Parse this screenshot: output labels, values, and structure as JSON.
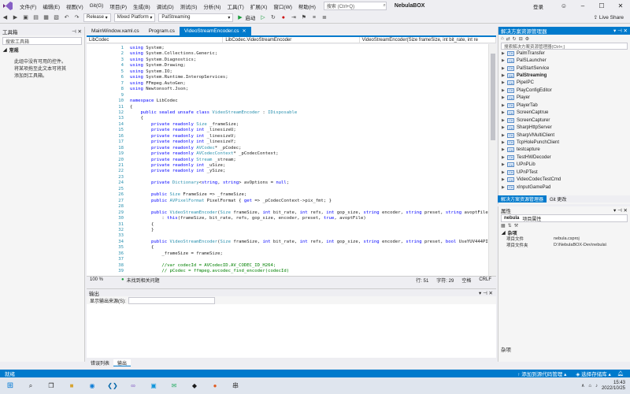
{
  "menu": {
    "items": [
      "文件(F)",
      "编辑(E)",
      "视图(V)",
      "Git(G)",
      "项目(P)",
      "生成(B)",
      "调试(D)",
      "测试(S)",
      "分析(N)",
      "工具(T)",
      "扩展(X)",
      "窗口(W)",
      "帮助(H)"
    ],
    "search_placeholder": "搜索 (Ctrl+Q)",
    "app_title": "NebulaBOX",
    "login": "登录"
  },
  "toolbar": {
    "config": "Release",
    "platform": "Mixed Platform",
    "startup_project": "PalStreaming",
    "start_label": "启动",
    "live_share": "Live Share"
  },
  "toolbox": {
    "title": "工具箱",
    "search_placeholder": "搜索工具箱",
    "group": "常规",
    "message": "此组中没有可用的控件。将某项拖至此文本可将其添加到工具箱。"
  },
  "tabs": [
    {
      "label": "MainWindow.xaml.cs"
    },
    {
      "label": "Program.cs"
    },
    {
      "label": "VideoStreamEncoder.cs"
    }
  ],
  "navbar": {
    "project": "LibCodec",
    "class": "LibCodec.VideoStreamEncoder",
    "member": "VideoStreamEncoder(Size frameSize, int bit_rate, int re"
  },
  "code_lines": [
    {
      "n": "1",
      "html": "<span class=\"kw\">using</span> System;"
    },
    {
      "n": "2",
      "html": "<span class=\"kw\">using</span> System.Collections.Generic;"
    },
    {
      "n": "3",
      "html": "<span class=\"kw\">using</span> System.Diagnostics;"
    },
    {
      "n": "4",
      "html": "<span class=\"kw\">using</span> System.Drawing;"
    },
    {
      "n": "5",
      "html": "<span class=\"kw\">using</span> System.IO;"
    },
    {
      "n": "6",
      "html": "<span class=\"kw\">using</span> System.Runtime.InteropServices;"
    },
    {
      "n": "7",
      "html": "<span class=\"kw\">using</span> FFmpeg.AutoGen;"
    },
    {
      "n": "8",
      "html": "<span class=\"kw\">using</span> Newtonsoft.Json;"
    },
    {
      "n": "9",
      "html": ""
    },
    {
      "n": "10",
      "html": "<span class=\"kw\">namespace</span> LibCodec"
    },
    {
      "n": "11",
      "html": "{"
    },
    {
      "n": "12",
      "html": "    <span class=\"kw\">public sealed unsafe class</span> <span class=\"ty\">VideoStreamEncoder</span> : <span class=\"ty\">IDisposable</span>"
    },
    {
      "n": "13",
      "html": "    {"
    },
    {
      "n": "14",
      "html": "        <span class=\"kw\">private readonly</span> <span class=\"ty\">Size</span> _frameSize;"
    },
    {
      "n": "15",
      "html": "        <span class=\"kw\">private readonly int</span> _linesizeU;"
    },
    {
      "n": "16",
      "html": "        <span class=\"kw\">private readonly int</span> _linesizeV;"
    },
    {
      "n": "17",
      "html": "        <span class=\"kw\">private readonly int</span> _linesizeY;"
    },
    {
      "n": "18",
      "html": "        <span class=\"kw\">private readonly</span> <span class=\"ty\">AVCodec</span>* _pCodec;"
    },
    {
      "n": "19",
      "html": "        <span class=\"kw\">private readonly</span> <span class=\"ty\">AVCodecContext</span>* _pCodecContext;"
    },
    {
      "n": "20",
      "html": "        <span class=\"kw\">private readonly</span> <span class=\"ty\">Stream</span> _stream;"
    },
    {
      "n": "21",
      "html": "        <span class=\"kw\">private readonly int</span> _uSize;"
    },
    {
      "n": "22",
      "html": "        <span class=\"kw\">private readonly int</span> _ySize;"
    },
    {
      "n": "23",
      "html": ""
    },
    {
      "n": "24",
      "html": "        <span class=\"kw\">private</span> <span class=\"ty\">Dictionary</span>&lt;<span class=\"kw\">string</span>, <span class=\"kw\">string</span>&gt; avOptions = <span class=\"kw\">null</span>;"
    },
    {
      "n": "25",
      "html": ""
    },
    {
      "n": "26",
      "html": "        <span class=\"kw\">public</span> <span class=\"ty\">Size</span> FrameSize =&gt; _frameSize;"
    },
    {
      "n": "27",
      "html": "        <span class=\"kw\">public</span> <span class=\"ty\">AVPixelFormat</span> PixelFormat { <span class=\"kw\">get</span> =&gt; _pCodecContext-&gt;pix_fmt; }"
    },
    {
      "n": "28",
      "html": ""
    },
    {
      "n": "29",
      "html": "        <span class=\"kw\">public</span> <span class=\"ty\">VideoStreamEncoder</span>(<span class=\"ty\">Size</span> frameSize, <span class=\"kw\">int</span> bit_rate, <span class=\"kw\">int</span> refs, <span class=\"kw\">int</span> gop_size, <span class=\"kw\">string</span> encoder, <span class=\"kw\">string</span> preset, <span class=\"kw\">string</span> avoptFile"
    },
    {
      "n": "30",
      "html": "            : <span class=\"kw\">this</span>(frameSize, bit_rate, refs, gop_size, encoder, preset, <span class=\"kw\">true</span>, avoptFile)"
    },
    {
      "n": "31",
      "html": "        {"
    },
    {
      "n": "32",
      "html": "        }"
    },
    {
      "n": "33",
      "html": ""
    },
    {
      "n": "34",
      "html": "        <span class=\"kw\">public</span> <span class=\"ty\">VideoStreamEncoder</span>(<span class=\"ty\">Size</span> frameSize, <span class=\"kw\">int</span> bit_rate, <span class=\"kw\">int</span> refs, <span class=\"kw\">int</span> gop_size, <span class=\"kw\">string</span> encoder, <span class=\"kw\">string</span> preset, <span class=\"kw\">bool</span> UseYUV444PIt"
    },
    {
      "n": "35",
      "html": "        {"
    },
    {
      "n": "36",
      "html": "            _frameSize = frameSize;"
    },
    {
      "n": "37",
      "html": ""
    },
    {
      "n": "38",
      "html": "            <span class=\"cm\">//var codecId = AVCodecID.AV_CODEC_ID_H264;</span>"
    },
    {
      "n": "39",
      "html": "            <span class=\"cm\">// pCodec = ffmpeg.avcodec_find_encoder(codecId)</span>"
    }
  ],
  "editor_status": {
    "zoom": "100 %",
    "issues": "未找到相关问题",
    "line": "行: 51",
    "char": "字符: 29",
    "spaces": "空格",
    "eol": "CRLF"
  },
  "output": {
    "title": "输出",
    "source_label": "显示输出来源(S):"
  },
  "bottom_tabs": [
    "错误列表",
    "输出"
  ],
  "solution": {
    "title": "解决方案资源管理器",
    "search_placeholder": "搜索解决方案资源管理器(Ctrl+;)",
    "items": [
      {
        "label": "PalmTransfer",
        "bold": false
      },
      {
        "label": "PalSLauncher",
        "bold": false
      },
      {
        "label": "PalStartService",
        "bold": false
      },
      {
        "label": "PalStreaming",
        "bold": true
      },
      {
        "label": "PipeIPC",
        "bold": false
      },
      {
        "label": "PlayConfigEditor",
        "bold": false
      },
      {
        "label": "Player",
        "bold": false
      },
      {
        "label": "PlayerTab",
        "bold": false
      },
      {
        "label": "ScreenCaptrue",
        "bold": false
      },
      {
        "label": "ScreenCapturer",
        "bold": false
      },
      {
        "label": "SharpHttpServer",
        "bold": false
      },
      {
        "label": "SharpVMultiClient",
        "bold": false
      },
      {
        "label": "TcpHolePunchClient",
        "bold": false
      },
      {
        "label": "testcapture",
        "bold": false
      },
      {
        "label": "TestHWDecoder",
        "bold": false
      },
      {
        "label": "UPnPLib",
        "bold": false
      },
      {
        "label": "UPnPTest",
        "bold": false
      },
      {
        "label": "VideoCodecTestCmd",
        "bold": false
      },
      {
        "label": "xInputGamePad",
        "bold": false
      }
    ],
    "tabs": [
      "解决方案资源管理器",
      "Git 更改"
    ]
  },
  "properties": {
    "title": "属性",
    "object": "nebula",
    "object_type": "项目属性",
    "category": "杂项",
    "rows": [
      {
        "key": "项目文件",
        "value": "nebula.csproj"
      },
      {
        "key": "项目文件夹",
        "value": "D:\\NebulaBOX-Dev\\nebula\\"
      }
    ],
    "section": "杂项"
  },
  "statusbar": {
    "ready": "就绪",
    "add_source": "添加到源代码管理",
    "select_repo": "选择存储库"
  },
  "taskbar": {
    "time": "15:43",
    "date": "2022/10/25"
  },
  "colors": {
    "accent": "#007acc",
    "keyword": "#0000ff",
    "type": "#2b91af",
    "comment": "#008000"
  }
}
